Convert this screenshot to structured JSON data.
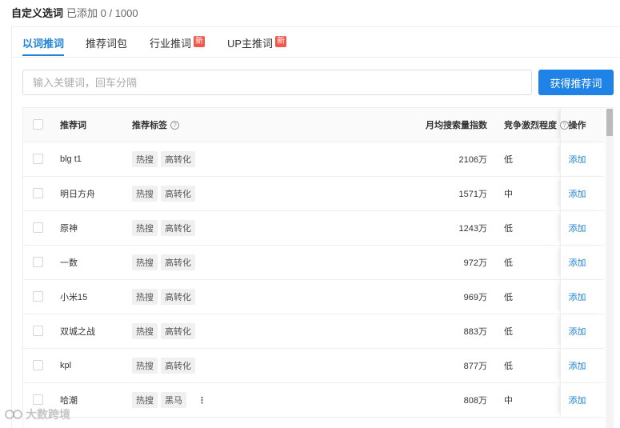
{
  "header": {
    "title": "自定义选词",
    "count": "已添加 0 / 1000"
  },
  "tabs": [
    {
      "label": "以词推词",
      "active": true,
      "is_new": false
    },
    {
      "label": "推荐词包",
      "active": false,
      "is_new": false
    },
    {
      "label": "行业推词",
      "active": false,
      "is_new": true
    },
    {
      "label": "UP主推词",
      "active": false,
      "is_new": true
    }
  ],
  "new_badge": "新",
  "search": {
    "placeholder": "输入关键词，回车分隔",
    "value": ""
  },
  "get_button": "获得推荐词",
  "table": {
    "headers": {
      "word": "推荐词",
      "tags": "推荐标签",
      "volume": "月均搜索量指数",
      "competition": "竞争激烈程度",
      "operation": "操作"
    },
    "rows": [
      {
        "word": "blg t1",
        "tags": [
          "热搜",
          "高转化"
        ],
        "volume": "2106万",
        "competition": "低",
        "action": "添加",
        "more": false
      },
      {
        "word": "明日方舟",
        "tags": [
          "热搜",
          "高转化"
        ],
        "volume": "1571万",
        "competition": "中",
        "action": "添加",
        "more": false
      },
      {
        "word": "原神",
        "tags": [
          "热搜",
          "高转化"
        ],
        "volume": "1243万",
        "competition": "低",
        "action": "添加",
        "more": false
      },
      {
        "word": "一数",
        "tags": [
          "热搜",
          "高转化"
        ],
        "volume": "972万",
        "competition": "低",
        "action": "添加",
        "more": false
      },
      {
        "word": "小米15",
        "tags": [
          "热搜",
          "高转化"
        ],
        "volume": "969万",
        "competition": "低",
        "action": "添加",
        "more": false
      },
      {
        "word": "双城之战",
        "tags": [
          "热搜",
          "高转化"
        ],
        "volume": "883万",
        "competition": "低",
        "action": "添加",
        "more": false
      },
      {
        "word": "kpl",
        "tags": [
          "热搜",
          "高转化"
        ],
        "volume": "877万",
        "competition": "低",
        "action": "添加",
        "more": false
      },
      {
        "word": "哈潮",
        "tags": [
          "热搜",
          "黑马"
        ],
        "volume": "808万",
        "competition": "中",
        "action": "添加",
        "more": true
      }
    ]
  },
  "icons": {
    "help": "question-circle-icon",
    "more": "more-vertical-icon"
  },
  "watermark": "大数跨境",
  "colors": {
    "accent": "#1e82d9",
    "button": "#1e82e6",
    "new_badge": "#f2564c"
  }
}
